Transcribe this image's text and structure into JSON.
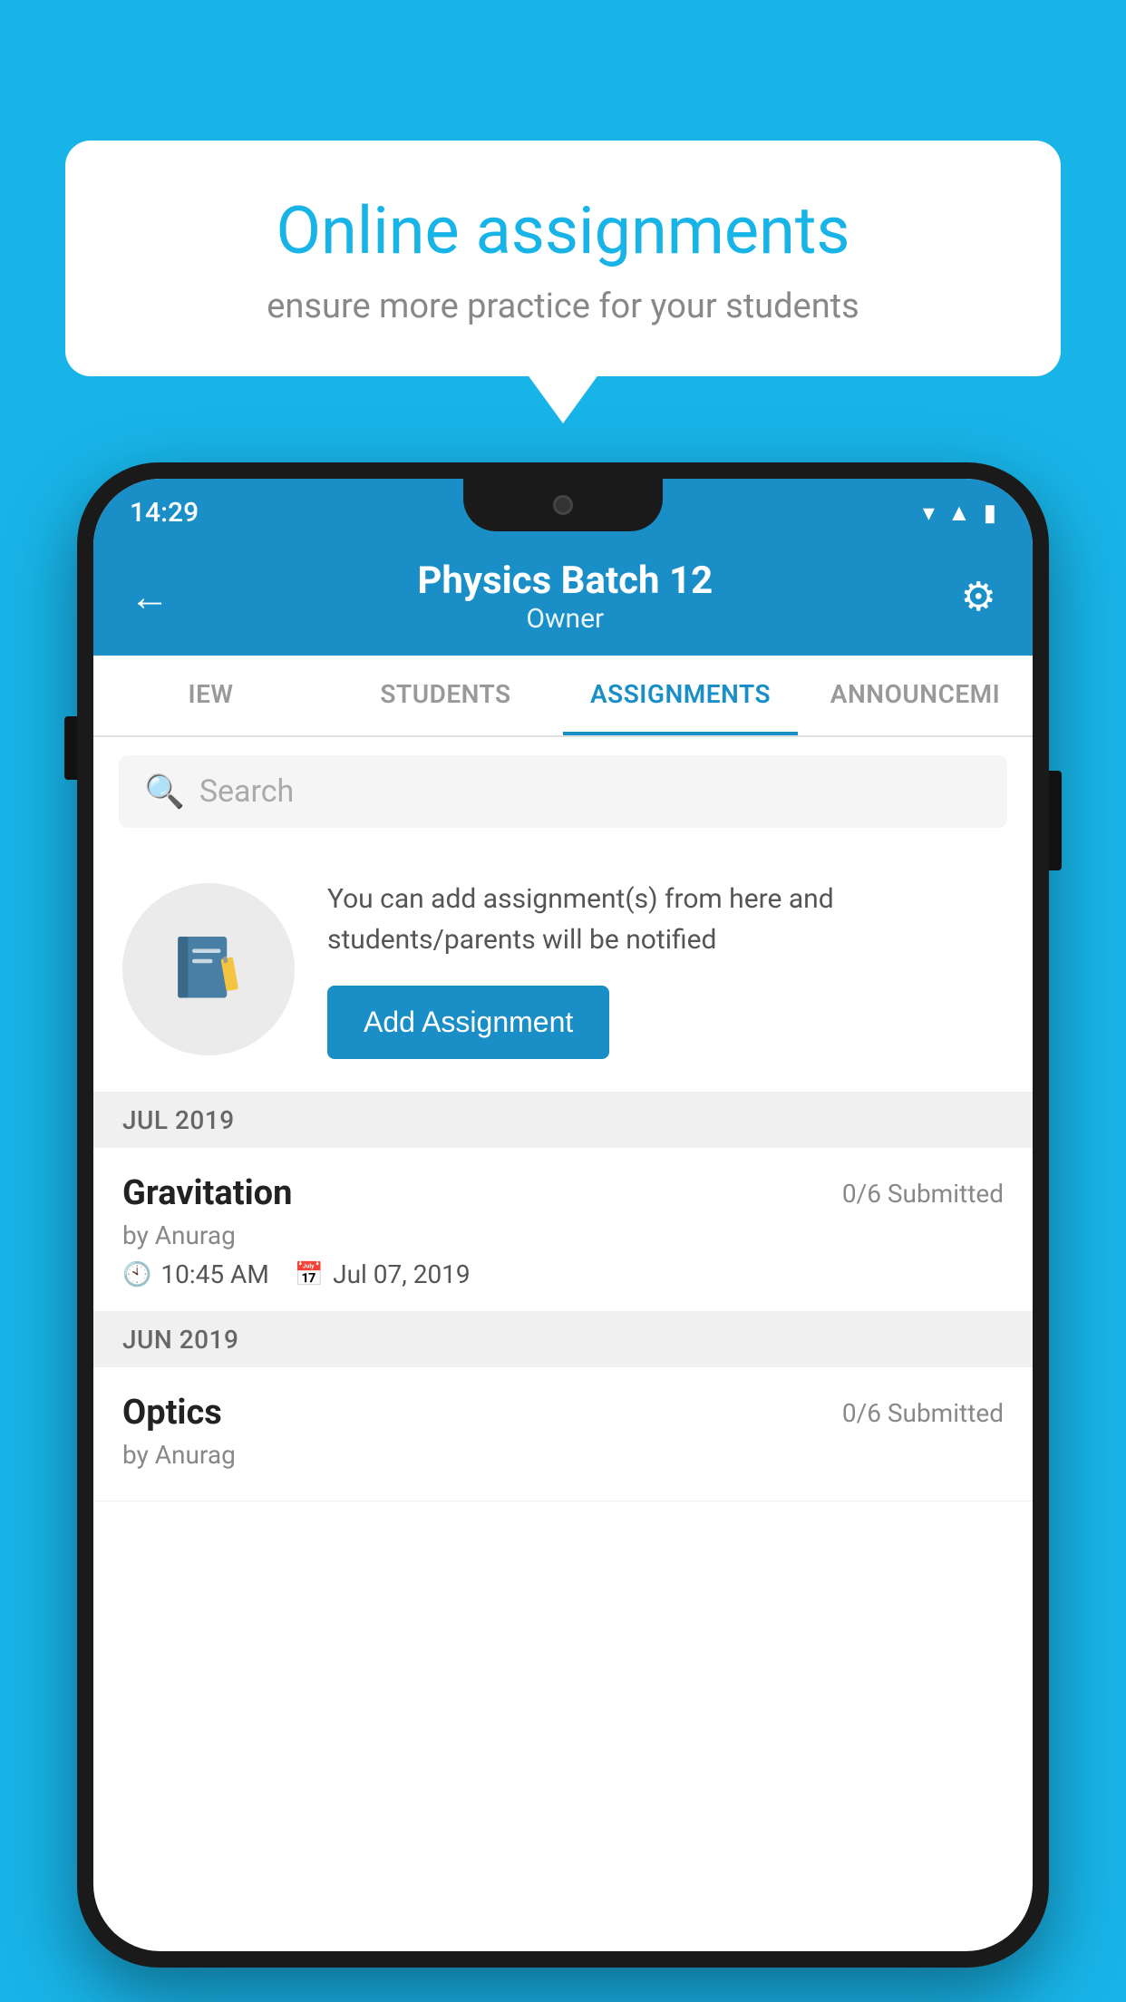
{
  "background_color": "#18b4e8",
  "speech_bubble": {
    "title": "Online assignments",
    "subtitle": "ensure more practice for your students"
  },
  "status_bar": {
    "time": "14:29",
    "icons": [
      "wifi",
      "signal",
      "battery"
    ]
  },
  "header": {
    "title": "Physics Batch 12",
    "subtitle": "Owner",
    "back_label": "←",
    "gear_label": "⚙"
  },
  "tabs": [
    {
      "label": "IEW",
      "active": false
    },
    {
      "label": "STUDENTS",
      "active": false
    },
    {
      "label": "ASSIGNMENTS",
      "active": true
    },
    {
      "label": "ANNOUNCEMI",
      "active": false
    }
  ],
  "search": {
    "placeholder": "Search"
  },
  "info_card": {
    "text": "You can add assignment(s) from here and students/parents will be notified",
    "button_label": "Add Assignment"
  },
  "sections": [
    {
      "month_label": "JUL 2019",
      "assignments": [
        {
          "name": "Gravitation",
          "submitted": "0/6 Submitted",
          "by": "by Anurag",
          "time": "10:45 AM",
          "date": "Jul 07, 2019"
        }
      ]
    },
    {
      "month_label": "JUN 2019",
      "assignments": [
        {
          "name": "Optics",
          "submitted": "0/6 Submitted",
          "by": "by Anurag",
          "time": "",
          "date": ""
        }
      ]
    }
  ]
}
